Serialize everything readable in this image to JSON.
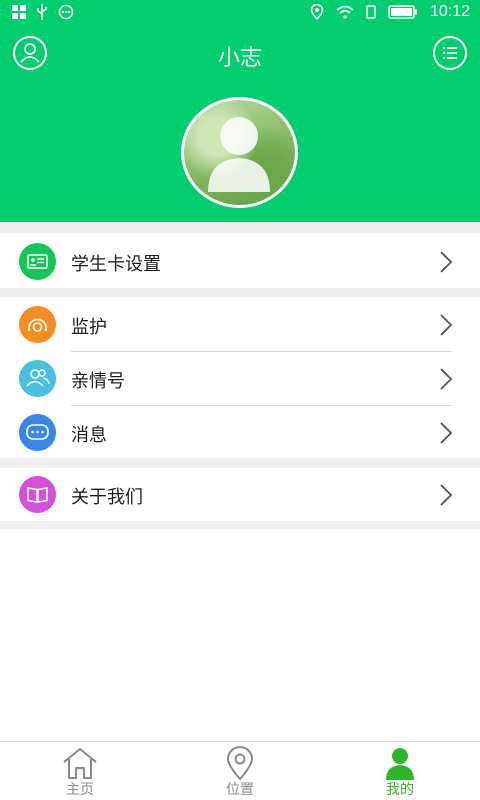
{
  "status_bar": {
    "time": "10:12"
  },
  "header": {
    "title": "小志"
  },
  "menu": {
    "student_card": "学生卡设置",
    "monitor": "监护",
    "family": "亲情号",
    "messages": "消息",
    "about": "关于我们"
  },
  "tabs": [
    {
      "label": "主页"
    },
    {
      "label": "位置"
    },
    {
      "label": "我的"
    }
  ],
  "colors": {
    "brand_green": "#03cd6f",
    "tab_active": "#2fb52a",
    "icon_student_card": "#16c45a",
    "icon_monitor": "#f68c22",
    "icon_family": "#4bbfe0",
    "icon_messages": "#3a86e8",
    "icon_about": "#d64fd8"
  }
}
